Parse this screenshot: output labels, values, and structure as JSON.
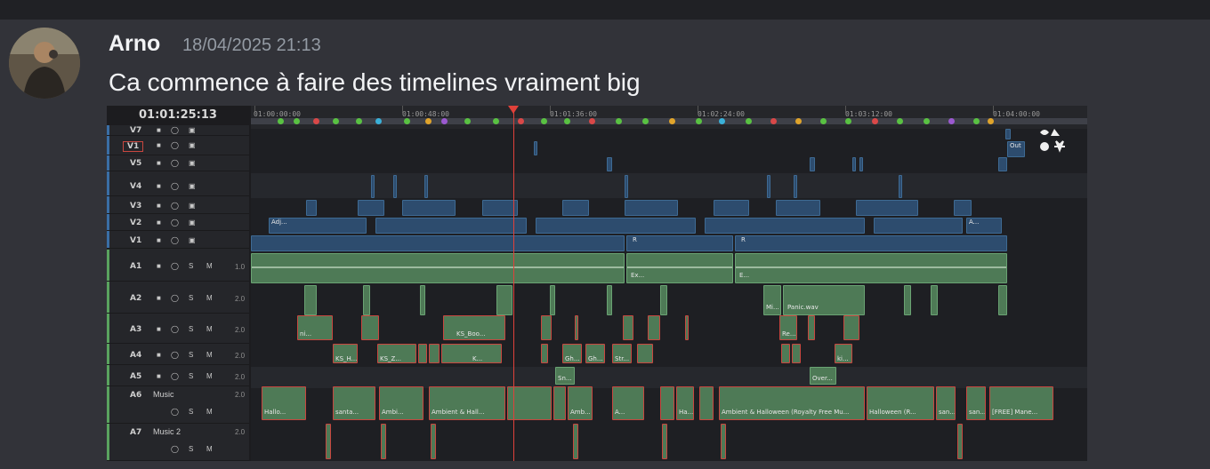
{
  "message": {
    "author": "Arno",
    "timestamp": "18/04/2025 21:13",
    "text": "Ca commence à faire des timelines vraiment big"
  },
  "timeline": {
    "timecode": "01:01:25:13",
    "ruler_labels": [
      "01:00:00:00",
      "01:00:48:00",
      "01:01:36:00",
      "01:02:24:00",
      "01:03:12:00",
      "01:04:00:00"
    ],
    "video_tracks": [
      "V7",
      "V1",
      "V5",
      "V4",
      "V3",
      "V2",
      "V1"
    ],
    "audio_tracks": [
      {
        "id": "A1",
        "name": "",
        "gain": "1.0"
      },
      {
        "id": "A2",
        "name": "",
        "gain": "2.0"
      },
      {
        "id": "A3",
        "name": "",
        "gain": "2.0"
      },
      {
        "id": "A4",
        "name": "",
        "gain": "2.0"
      },
      {
        "id": "A5",
        "name": "",
        "gain": "2.0"
      },
      {
        "id": "A6",
        "name": "Music",
        "gain": "2.0"
      },
      {
        "id": "A7",
        "name": "Music 2",
        "gain": "2.0"
      }
    ],
    "clip_labels": {
      "out": "Out",
      "adj": "Adj...",
      "a_v2": "A...",
      "r1": "R",
      "r2": "R",
      "ex1": "Ex...",
      "e2": "E...",
      "mi": "Mi...",
      "panic": "Panic.wav",
      "ni": "ni...",
      "ks_boo": "KS_Boo...",
      "re": "Re...",
      "ks_h": "KS_H...",
      "ks_z": "KS_Z...",
      "k": "K...",
      "gh1": "Gh...",
      "gh2": "Gh...",
      "str": "Str...",
      "ki": "ki...",
      "sn": "Sn...",
      "over": "Over...",
      "hallo": "Hallo...",
      "santa": "santa...",
      "ambi": "Ambi...",
      "ambient_hall": "Ambient & Hall...",
      "amb": "Amb...",
      "a6_a": "A...",
      "ha": "Ha...",
      "ambient_full": "Ambient & Halloween (Royalty Free Mu...",
      "halloween_r": "Halloween (R...",
      "san1": "san...",
      "san2": "san...",
      "free_mane": "[FREE] Mane..."
    }
  }
}
